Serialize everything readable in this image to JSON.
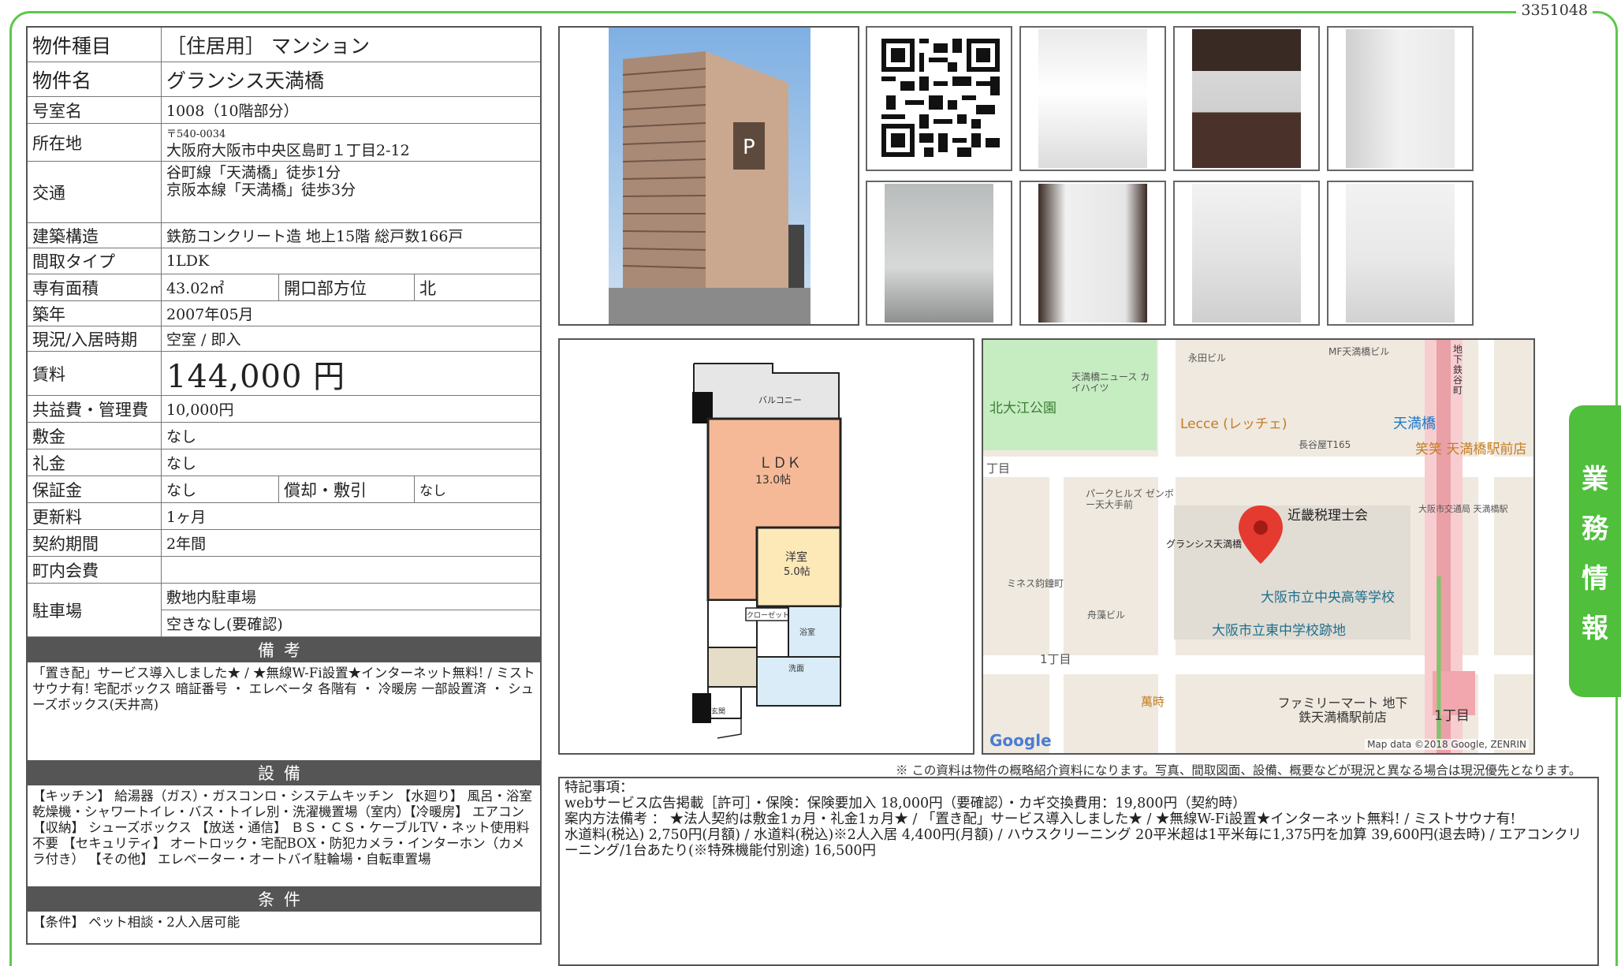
{
  "doc_id": "3351048",
  "table": {
    "property_type": {
      "label": "物件種目",
      "value": "［住居用］ マンション"
    },
    "property_name": {
      "label": "物件名",
      "value": "グランシス天満橋"
    },
    "room_no": {
      "label": "号室名",
      "value": "1008（10階部分）"
    },
    "address": {
      "label": "所在地",
      "postal": "〒540-0034",
      "value": "大阪府大阪市中央区島町１丁目2-12"
    },
    "transit": {
      "label": "交通",
      "line1": "谷町線「天満橋」徒歩1分",
      "line2": "京阪本線「天満橋」徒歩3分"
    },
    "structure": {
      "label": "建築構造",
      "value": "鉄筋コンクリート造 地上15階 総戸数166戸"
    },
    "layout": {
      "label": "間取タイプ",
      "value": "1LDK"
    },
    "area": {
      "label": "専有面積",
      "value": "43.02㎡",
      "dir_label": "開口部方位",
      "dir_value": "北"
    },
    "built": {
      "label": "築年",
      "value": "2007年05月"
    },
    "status": {
      "label": "現況/入居時期",
      "value": "空室 / 即入"
    },
    "rent": {
      "label": "賃料",
      "value": "144,000 円"
    },
    "fee": {
      "label": "共益費・管理費",
      "value": "10,000円"
    },
    "deposit": {
      "label": "敷金",
      "value": "なし"
    },
    "key_money": {
      "label": "礼金",
      "value": "なし"
    },
    "guarantee": {
      "label": "保証金",
      "value": "なし",
      "amort_label": "償却・敷引",
      "amort_value": "なし"
    },
    "renewal": {
      "label": "更新料",
      "value": "1ヶ月"
    },
    "term": {
      "label": "契約期間",
      "value": "2年間"
    },
    "community": {
      "label": "町内会費",
      "value": ""
    },
    "parking": {
      "label": "駐車場",
      "value1": "敷地内駐車場",
      "value2": "空きなし(要確認)"
    }
  },
  "remarks": {
    "head": "備考",
    "text": "「置き配」サービス導入しました★ / ★無線W-Fi設置★インターネット無料! / ミストサウナ有! 宅配ボックス 暗証番号 ・ エレベータ 各階有 ・ 冷暖房 一部設置済 ・ シューズボックス(天井高)"
  },
  "facilities": {
    "head": "設備",
    "text": "【キッチン】 給湯器（ガス）・ガスコンロ・システムキッチン 【水廻り】 風呂・浴室乾燥機・シャワートイレ・バス・トイレ別・洗濯機置場（室内）【冷暖房】 エアコン 【収納】 シューズボックス 【放送・通信】 ＢＳ・ＣＳ・ケーブルTV・ネット使用料不要 【セキュリティ】 オートロック・宅配BOX・防犯カメラ・インターホン（カメラ付き） 【その他】 エレベーター・オートバイ駐輪場・自転車置場"
  },
  "conditions": {
    "head": "条件",
    "text": "【条件】 ペット相談・2人入居可能"
  },
  "floorplan": {
    "balcony": "バルコニー",
    "ldk": "ＬＤＫ",
    "ldk_size": "13.0帖",
    "western": "洋室",
    "western_size": "5.0帖",
    "closet": "クローゼット",
    "bath": "浴室",
    "washroom": "洗面",
    "entrance": "玄関"
  },
  "map": {
    "labels": [
      "永田ビル",
      "MF天満橋ビル",
      "天満橋ニュース カイハイツ",
      "北大江公園",
      "Lecce (レッチェ)",
      "天満橋",
      "長谷屋T165",
      "笑笑 天満橋駅前店",
      "丁目",
      "パークヒルズ ゼンボー天大手前",
      "近畿税理士会",
      "大阪市交通局 天満橋駅",
      "グランシス天満橋",
      "大阪市立中央高等学校",
      "ミネス鈞鐘町",
      "舟藻ビル",
      "大阪市立東中学校跡地",
      "1丁目",
      "萬時",
      "ファミリーマート 地下鉄天満橋駅前店",
      "1丁目",
      "地下鉄谷町"
    ],
    "credit": "Map data ©2018 Google, ZENRIN",
    "logo": "Google"
  },
  "disclaimer": "※ この資料は物件の概略紹介資料になります。写真、間取図面、設備、概要などが現況と異なる場合は現況優先となります。",
  "special_notes": {
    "title": "特記事項：",
    "line1": "webサービス広告掲載［許可］・保険：保険要加入 18,000円（要確認）・カギ交換費用：19,800円（契約時）",
    "line2": "案内方法備考 ： ★法人契約は敷金1ヵ月・礼金1ヵ月★ / 「置き配」サービス導入しました★ / ★無線W-Fi設置★インターネット無料! / ミストサウナ有!",
    "line3": "水道料(税込) 2,750円(月額) / 水道料(税込)※2人入居 4,400円(月額) / ハウスクリーニング 20平米超は1平米毎に1,375円を加算 39,600円(退去時) / エアコンクリーニング/1台あたり(※特殊機能付別途) 16,500円"
  },
  "side_tab": [
    "業",
    "務",
    "情",
    "報"
  ],
  "colors": {
    "accent": "#4fbf3c",
    "header": "#555555"
  }
}
